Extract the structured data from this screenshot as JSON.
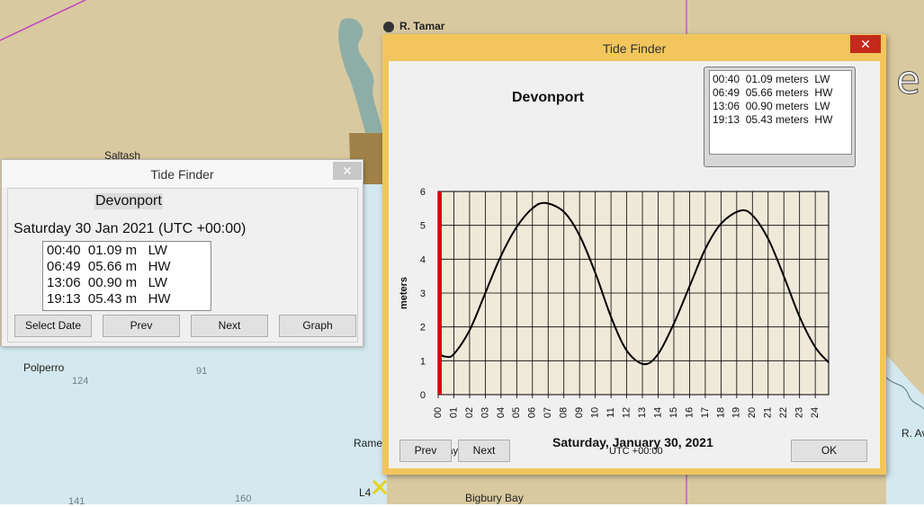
{
  "map": {
    "labels": {
      "tamar": "R. Tamar",
      "saltash": "Saltash",
      "polperro": "Polperro",
      "rame": "Rame",
      "bigbury": "Bigbury Bay",
      "ravon": "R. Av",
      "l4": "L4",
      "big_letter": "e"
    },
    "depths": {
      "d124": "124",
      "d91": "91",
      "d141": "141",
      "d160": "160"
    },
    "colors": {
      "land": "#d9c9a0",
      "sea": "#d3e8ef",
      "shallow": "#7fa9a8",
      "harbour": "#a08248",
      "route": "#c040c0"
    }
  },
  "small_window": {
    "title": "Tide Finder",
    "station": "Devonport",
    "date": "Saturday 30 Jan 2021 (UTC +00:00)",
    "tides": [
      "00:40  01.09 m   LW",
      "06:49  05.66 m   HW",
      "13:06  00.90 m   LW",
      "19:13  05.43 m   HW"
    ],
    "buttons": {
      "select_date": "Select Date",
      "prev": "Prev",
      "next": "Next",
      "graph": "Graph"
    },
    "close": "✕"
  },
  "big_window": {
    "title": "Tide Finder",
    "station": "Devonport",
    "tides": [
      "00:40  01.09 meters  LW",
      "06:49  05.66 meters  HW",
      "13:06  00.90 meters  LW",
      "19:13  05.43 meters  HW"
    ],
    "day_label": "Saturday",
    "tz_label": "UTC +00:00",
    "date": "Saturday, January 30, 2021",
    "buttons": {
      "prev": "Prev",
      "next": "Next",
      "ok": "OK"
    },
    "close": "✕",
    "colors": {
      "frame": "#f2c65c",
      "plot_bg": "#efe9d9",
      "now_marker": "#dd0000"
    }
  },
  "chart_data": {
    "type": "line",
    "ylabel": "meters",
    "ylim": [
      0,
      6
    ],
    "yticks": [
      "0",
      "1",
      "2",
      "3",
      "4",
      "5",
      "6"
    ],
    "xlim": [
      0,
      24.85
    ],
    "xticks": [
      "00",
      "01",
      "02",
      "03",
      "04",
      "05",
      "06",
      "07",
      "08",
      "09",
      "10",
      "11",
      "12",
      "13",
      "14",
      "15",
      "16",
      "17",
      "18",
      "19",
      "20",
      "21",
      "22",
      "23",
      "24"
    ],
    "grid": true,
    "extremes": [
      {
        "hour": 0.667,
        "height": 1.09
      },
      {
        "hour": 6.817,
        "height": 5.66
      },
      {
        "hour": 13.1,
        "height": 0.9
      },
      {
        "hour": 19.217,
        "height": 5.43
      }
    ],
    "series": [
      {
        "x": [
          0,
          0.5,
          1,
          2,
          3,
          4,
          5,
          6,
          6.8,
          8,
          9,
          10,
          11,
          12,
          13.1,
          14,
          15,
          16,
          17,
          18,
          19.2,
          20,
          21,
          22,
          23,
          24,
          24.85
        ],
        "values": [
          1.2,
          1.12,
          1.2,
          1.9,
          3.0,
          4.1,
          4.95,
          5.5,
          5.66,
          5.4,
          4.7,
          3.6,
          2.3,
          1.3,
          0.9,
          1.2,
          2.1,
          3.2,
          4.3,
          5.05,
          5.43,
          5.3,
          4.6,
          3.5,
          2.3,
          1.4,
          0.95
        ]
      }
    ],
    "now_marker_hour": 0
  }
}
